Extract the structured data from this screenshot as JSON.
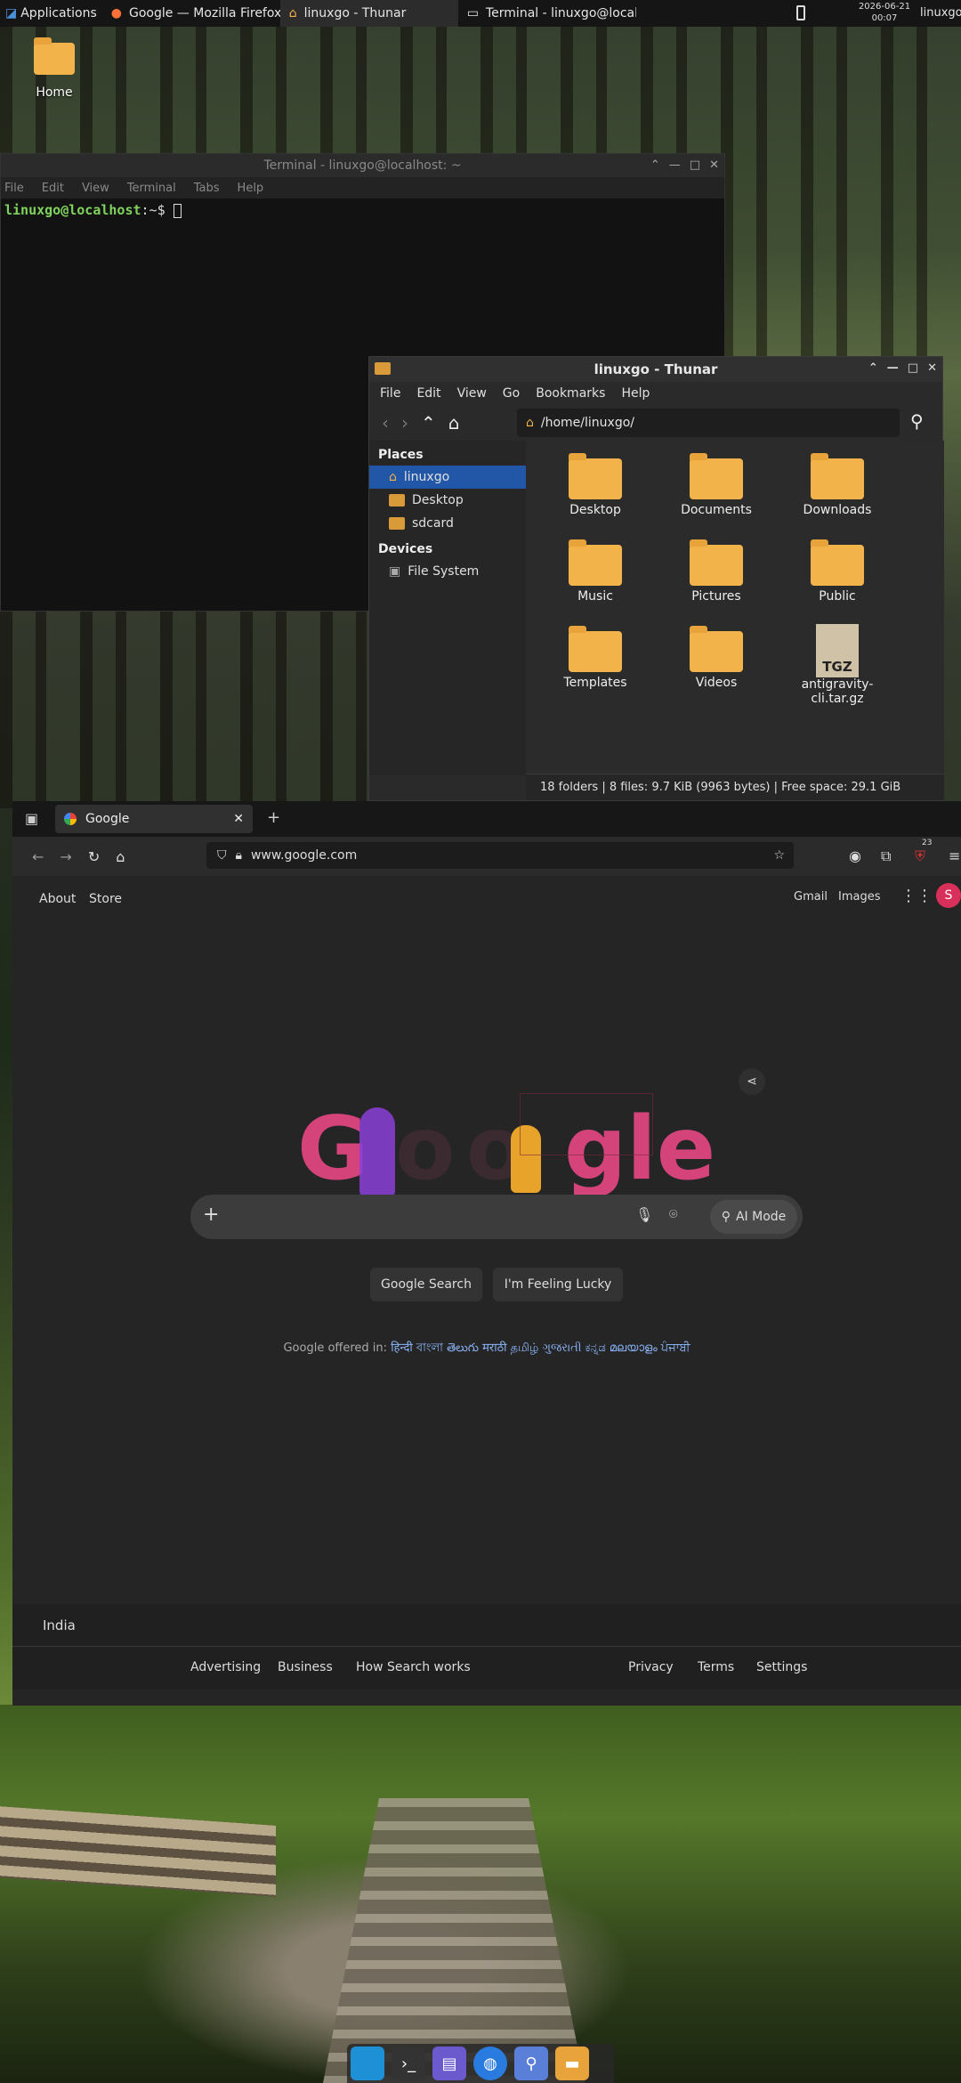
{
  "topbar": {
    "apps_label": "Applications",
    "tasks": [
      {
        "label": "Google — Mozilla Firefox"
      },
      {
        "label": "linuxgo - Thunar"
      },
      {
        "label": "Terminal - linuxgo@localh..."
      }
    ],
    "date": "2026-06-21",
    "time": "00:07",
    "user": "linuxgo"
  },
  "desktop": {
    "home_label": "Home"
  },
  "terminal": {
    "title": "Terminal - linuxgo@localhost: ~",
    "menu": [
      "File",
      "Edit",
      "View",
      "Terminal",
      "Tabs",
      "Help"
    ],
    "prompt_user": "linuxgo@localhost",
    "prompt_rest": ":~$"
  },
  "thunar": {
    "title": "linuxgo - Thunar",
    "menu": [
      "File",
      "Edit",
      "View",
      "Go",
      "Bookmarks",
      "Help"
    ],
    "path": "/home/linuxgo/",
    "places_header": "Places",
    "places": [
      "linuxgo",
      "Desktop",
      "sdcard"
    ],
    "devices_header": "Devices",
    "devices": [
      "File System"
    ],
    "items": [
      "Desktop",
      "Documents",
      "Downloads",
      "Music",
      "Pictures",
      "Public",
      "Templates",
      "Videos",
      "antigravity-cli.tar.gz"
    ],
    "tgz_label": "TGZ",
    "status": "18 folders  |  8 files: 9.7 KiB (9963 bytes)  |  Free space: 29.1 GiB"
  },
  "firefox": {
    "tab_title": "Google",
    "url": "www.google.com",
    "extension_badge": "23",
    "page": {
      "about": "About",
      "store": "Store",
      "gmail": "Gmail",
      "images": "Images",
      "avatar": "S",
      "doodle_g": "G",
      "doodle_o": "o",
      "doodle_gle": "gle",
      "ai_mode": "AI Mode",
      "search_btn": "Google Search",
      "lucky_btn": "I'm Feeling Lucky",
      "offered_in": "Google offered in:",
      "languages": "हिन्दी  বাংলা  తెలుగు  मराठी  தமிழ்  ગુજરાતી  ಕನ್ನಡ  മലയാളം  ਪੰਜਾਬੀ",
      "country": "India",
      "footer": {
        "advertising": "Advertising",
        "business": "Business",
        "how": "How Search works",
        "privacy": "Privacy",
        "terms": "Terms",
        "settings": "Settings"
      }
    }
  },
  "colors": {
    "accent_selection": "#2257a8",
    "folder": "#f2b44a",
    "terminal_user": "#7fd35c",
    "doodle_pink": "#d4447a"
  }
}
